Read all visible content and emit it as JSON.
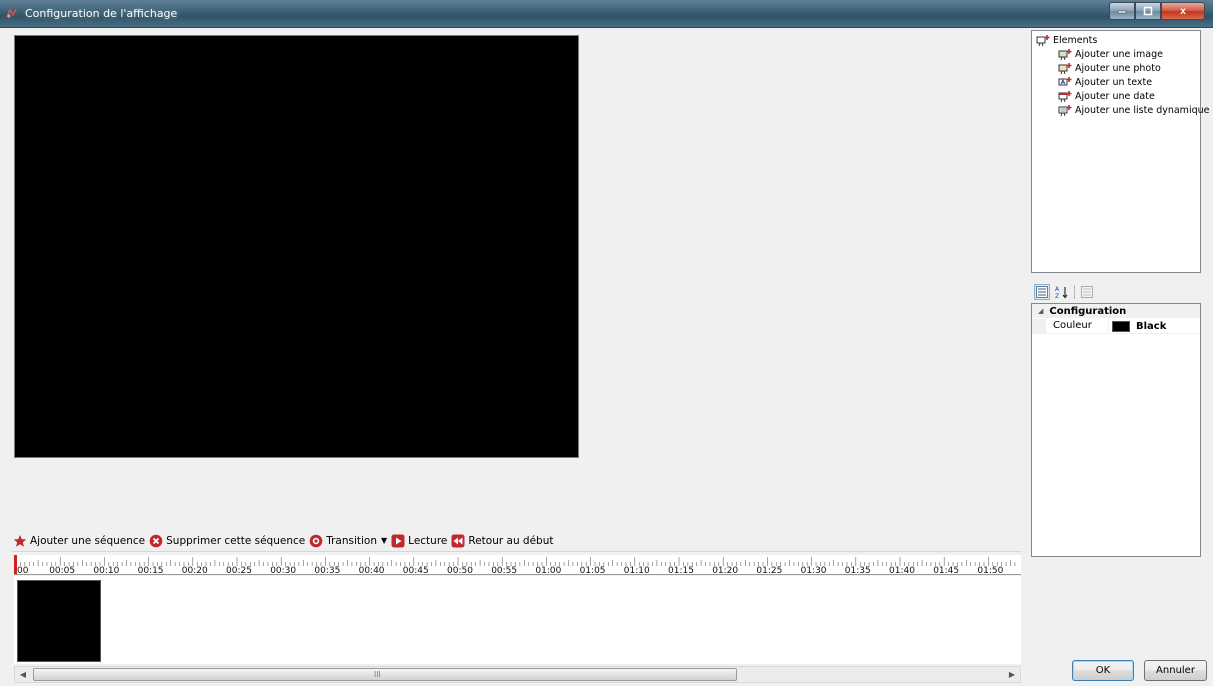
{
  "window": {
    "title": "Configuration de l'affichage",
    "controls": {
      "minimize": "–",
      "maximize": "□",
      "close": "x"
    }
  },
  "timeline_toolbar": {
    "add_sequence": "Ajouter une séquence",
    "delete_sequence": "Supprimer cette séquence",
    "transition": "Transition",
    "play": "Lecture",
    "rewind": "Retour au début"
  },
  "ruler": {
    "labels": [
      "00",
      "00:05",
      "00:10",
      "00:15",
      "00:20",
      "00:25",
      "00:30",
      "00:35",
      "00:40",
      "00:45",
      "00:50",
      "00:55",
      "01:00",
      "01:05",
      "01:10",
      "01:15",
      "01:20",
      "01:25",
      "01:30",
      "01:35",
      "01:40",
      "01:45",
      "01:50"
    ]
  },
  "scrollbar": {
    "grip": "III"
  },
  "elements_tree": {
    "root": "Elements",
    "items": [
      "Ajouter une image",
      "Ajouter une photo",
      "Ajouter un texte",
      "Ajouter une date",
      "Ajouter une liste dynamique"
    ]
  },
  "property_grid": {
    "category": "Configuration",
    "rows": [
      {
        "name": "Couleur",
        "value": "Black",
        "swatch": "#000000"
      }
    ]
  },
  "buttons": {
    "ok": "OK",
    "cancel": "Annuler"
  },
  "colors": {
    "canvas": "#000000",
    "playhead": "#d02020",
    "accent_red": "#c0282d"
  }
}
